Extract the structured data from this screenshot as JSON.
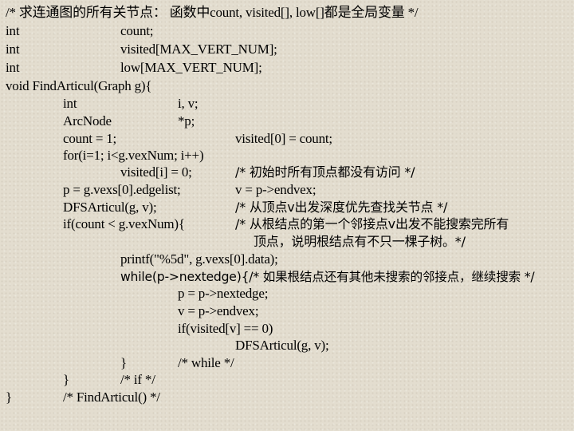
{
  "slide": {
    "lines": [
      {
        "segments": [
          "/* 求连通图的所有关节点： 函数中count, visited[], low[]都是全局变量 */"
        ]
      },
      {
        "segments": [
          "int",
          "count;"
        ]
      },
      {
        "segments": [
          "int",
          "visited[MAX_VERT_NUM];"
        ]
      },
      {
        "segments": [
          "int",
          "low[MAX_VERT_NUM];"
        ]
      },
      {
        "segments": [
          "void FindArticul(Graph g){"
        ]
      },
      {
        "segments": [
          "int",
          "i, v;"
        ]
      },
      {
        "segments": [
          "ArcNode",
          "*p;"
        ]
      },
      {
        "segments": [
          "count = 1;",
          "visited[0] = count;"
        ]
      },
      {
        "segments": [
          "for(i=1; i<g.vexNum; i++)"
        ]
      },
      {
        "segments": [
          "visited[i] = 0;",
          "/* 初始时所有顶点都没有访问 */"
        ]
      },
      {
        "segments": [
          "p = g.vexs[0].edgelist;",
          "v = p->endvex;"
        ]
      },
      {
        "segments": [
          "DFSArticul(g, v);",
          "/* 从顶点v出发深度优先查找关节点 */"
        ]
      },
      {
        "segments": [
          "if(count < g.vexNum){",
          "/* 从根结点的第一个邻接点v出发不能搜索完所有"
        ]
      },
      {
        "segments": [
          "顶点，说明根结点有不只一棵子树。*/"
        ]
      },
      {
        "segments": [
          "printf(\"%5d\", g.vexs[0].data);"
        ]
      },
      {
        "segments": [
          "while(p->nextedge){/* 如果根结点还有其他未搜索的邻接点，继续搜索 */"
        ]
      },
      {
        "segments": [
          "p = p->nextedge;"
        ]
      },
      {
        "segments": [
          "v = p->endvex;"
        ]
      },
      {
        "segments": [
          "if(visited[v] == 0)"
        ]
      },
      {
        "segments": [
          "DFSArticul(g, v);"
        ]
      },
      {
        "segments": [
          "}",
          "/* while */"
        ]
      },
      {
        "segments": [
          "}",
          "/* if */"
        ]
      },
      {
        "segments": [
          "}",
          "/* FindArticul() */"
        ]
      }
    ]
  }
}
